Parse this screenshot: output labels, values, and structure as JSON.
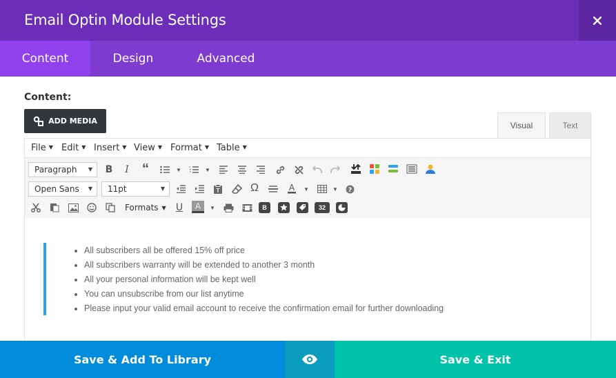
{
  "header": {
    "title": "Email Optin Module Settings",
    "close_icon": "close-icon"
  },
  "tabs": [
    {
      "label": "Content",
      "active": true
    },
    {
      "label": "Design",
      "active": false
    },
    {
      "label": "Advanced",
      "active": false
    }
  ],
  "content_label": "Content:",
  "add_media_label": "ADD MEDIA",
  "editor_modes": {
    "visual": "Visual",
    "text": "Text",
    "selected": "Visual"
  },
  "menubar": [
    "File",
    "Edit",
    "Insert",
    "View",
    "Format",
    "Table"
  ],
  "toolbar": {
    "block_format": "Paragraph",
    "font_family": "Open Sans",
    "font_size": "11pt",
    "formats_label": "Formats",
    "badge_b": "B",
    "badge_32": "32"
  },
  "content": {
    "bullets": [
      "All subscribers all be offered 15% off price",
      "All subscribers warranty will be extended to another 3 month",
      "All your personal information will be kept well",
      "You can unsubscribe from our list anytime",
      "Please input your valid email account to receive the confirmation email for further downloading"
    ]
  },
  "footer": {
    "save_library_label": "Save & Add To Library",
    "preview_icon": "eye-icon",
    "save_exit_label": "Save & Exit"
  },
  "colors": {
    "header_bg": "#6c2eb9",
    "tabs_bg": "#7e3bd0",
    "active_tab_bg": "#8f42ec",
    "library_button": "#008bdb",
    "preview_button": "#0a9cbf",
    "save_button": "#00c3aa",
    "quote_bar": "#2ea3f2"
  }
}
